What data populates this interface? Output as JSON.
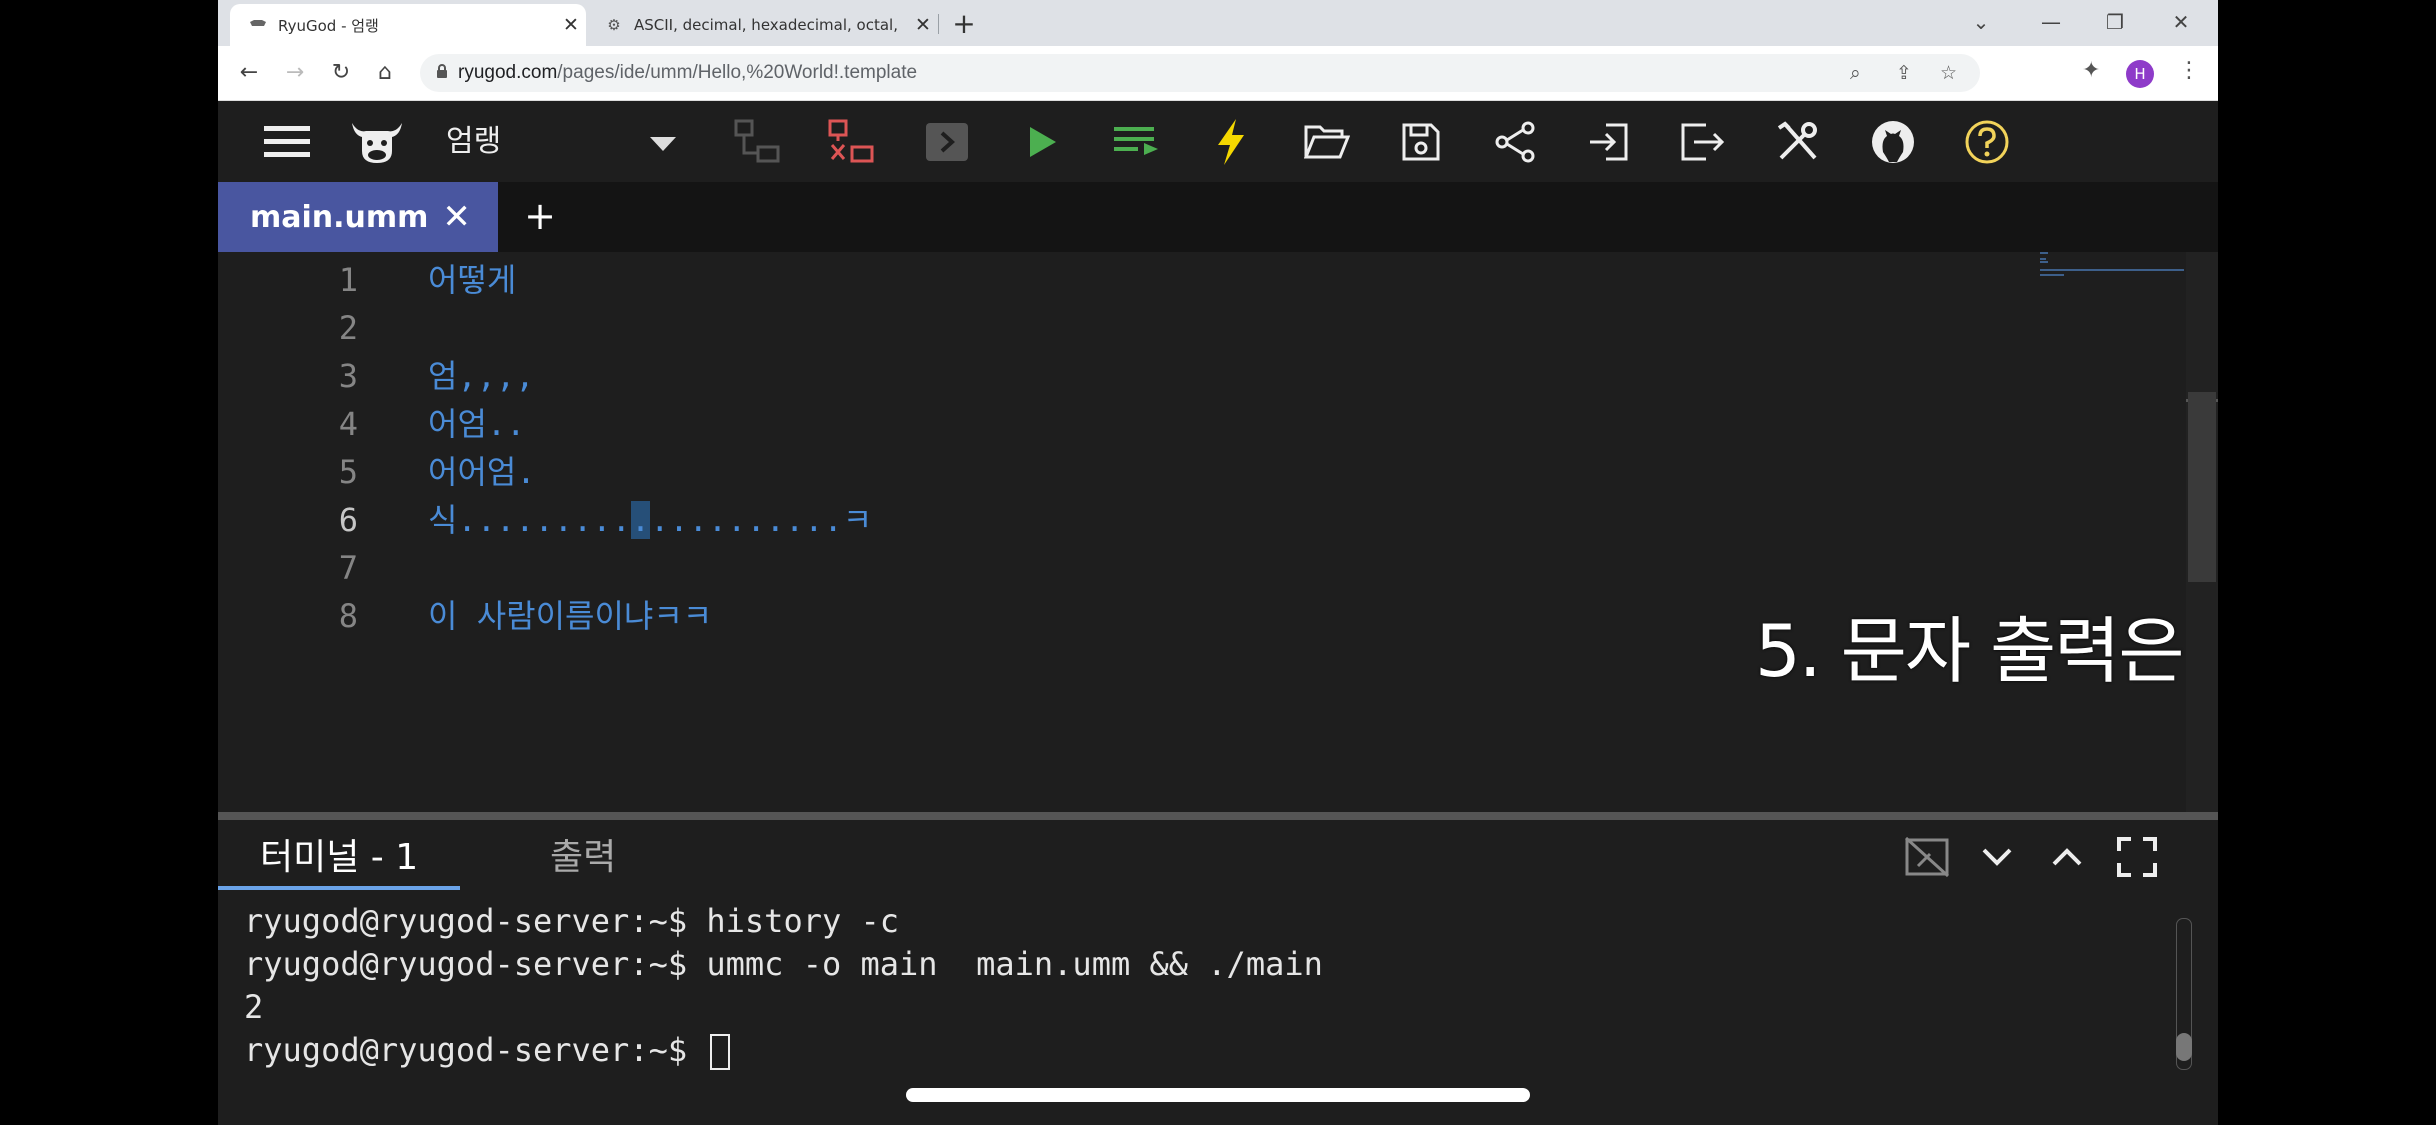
{
  "browser": {
    "tabs": [
      {
        "title": "RyuGod - 엄랭",
        "active": true
      },
      {
        "title": "ASCII, decimal, hexadecimal, octal,",
        "active": false
      }
    ],
    "url_domain": "ryugod.com",
    "url_path": "/pages/ide/umm/Hello,%20World!.template",
    "profile_initial": "H"
  },
  "toolbar": {
    "language": "엄랭",
    "icons": [
      "menu-icon",
      "cow-logo-icon",
      "debug-icon",
      "stop-debug-icon",
      "console-icon",
      "run-icon",
      "format-icon",
      "compile-icon",
      "open-folder-icon",
      "save-icon",
      "share-icon",
      "import-icon",
      "export-icon",
      "settings-tools-icon",
      "github-icon",
      "help-icon"
    ]
  },
  "editor": {
    "active_file": "main.umm",
    "add_tab_label": "+",
    "lines": [
      {
        "n": "1",
        "text": "어떻게"
      },
      {
        "n": "2",
        "text": ""
      },
      {
        "n": "3",
        "text": "엄,,,,"
      },
      {
        "n": "4",
        "text": "어엄.."
      },
      {
        "n": "5",
        "text": "어어엄."
      },
      {
        "n": "6",
        "pre": "식.........",
        "hl": ".",
        "post": "..........ㅋ"
      },
      {
        "n": "7",
        "text": ""
      },
      {
        "n": "8",
        "text": "이 사람이름이냐ㅋㅋ"
      }
    ],
    "overlay_caption": "5. 문자 출력은"
  },
  "panel": {
    "tabs": [
      "터미널 - 1",
      "출력"
    ],
    "terminal_lines": [
      "ryugod@ryugod-server:~$ history -c",
      "ryugod@ryugod-server:~$ ummc -o main  main.umm && ./main",
      "2",
      "ryugod@ryugod-server:~$ "
    ]
  },
  "colors": {
    "accent_tab": "#4956a0",
    "run_green": "#4caf50",
    "lightning_yellow": "#f5d800",
    "help_yellow": "#f2d35a",
    "code_blue": "#4a8bd6"
  }
}
